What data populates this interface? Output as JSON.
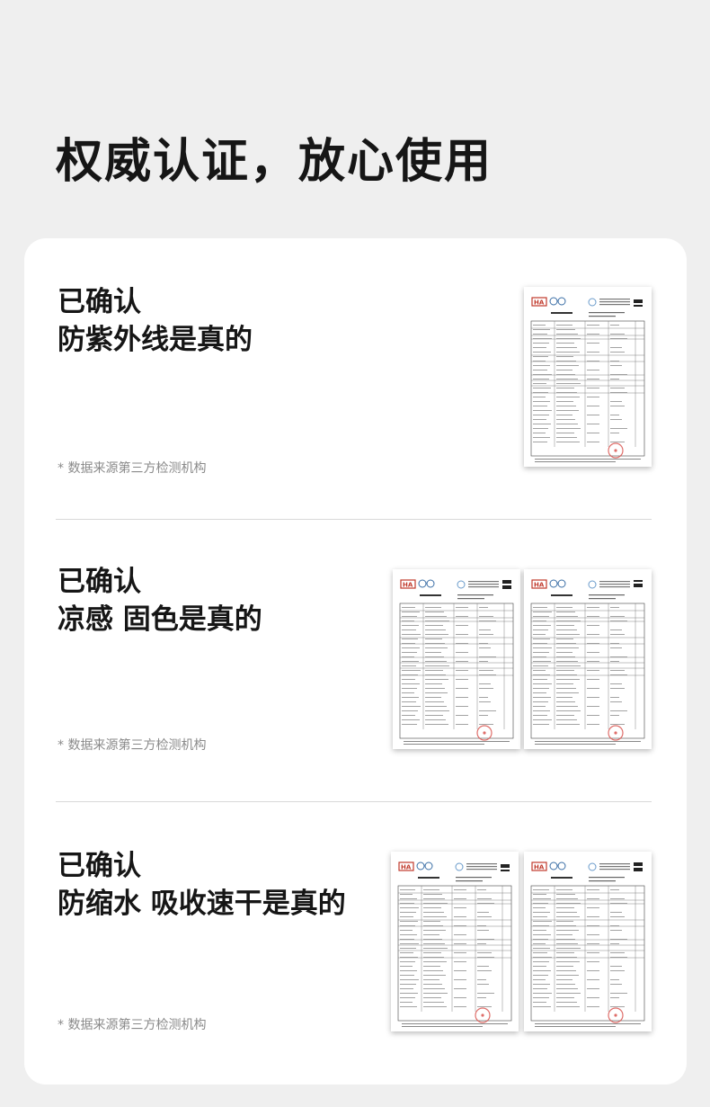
{
  "headline": "权威认证，放心使用",
  "sections": [
    {
      "title_line1": "已确认",
      "title_line2": "防紫外线是真的",
      "note": "* 数据来源第三方检测机构"
    },
    {
      "title_line1": "已确认",
      "title_line2": "凉感 固色是真的",
      "note": "* 数据来源第三方检测机构"
    },
    {
      "title_line1": "已确认",
      "title_line2": "防缩水 吸收速干是真的",
      "note": "* 数据来源第三方检测机构"
    }
  ],
  "report_thumbnail": {
    "logo_text": "HA",
    "seal_color": "#d9534f",
    "accent_color": "#c0392b"
  }
}
